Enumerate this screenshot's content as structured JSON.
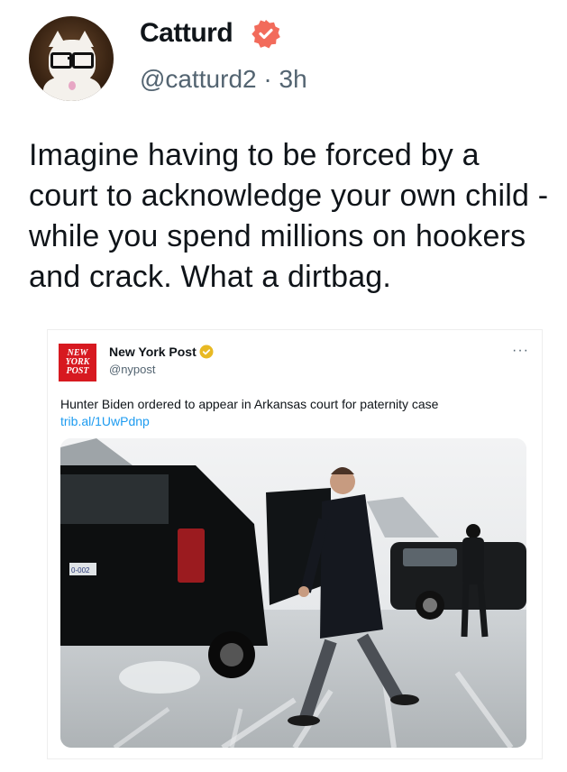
{
  "author": {
    "name": "Catturd",
    "handle": "@catturd2",
    "separator": "·",
    "time": "3h",
    "verified_color": "#f26b5b"
  },
  "tweet": {
    "text": "Imagine having to be forced by a court to acknowledge your own child - while you spend millions on hookers and crack. What a dirtbag."
  },
  "quoted": {
    "logo_text": "NEW YORK POST",
    "name": "New York Post",
    "handle": "@nypost",
    "more": "···",
    "text": "Hunter Biden ordered to appear in Arkansas court for paternity case",
    "link": "trib.al/1UwPdnp",
    "badge_color": "#e8b923",
    "plate_text": "0-002"
  }
}
